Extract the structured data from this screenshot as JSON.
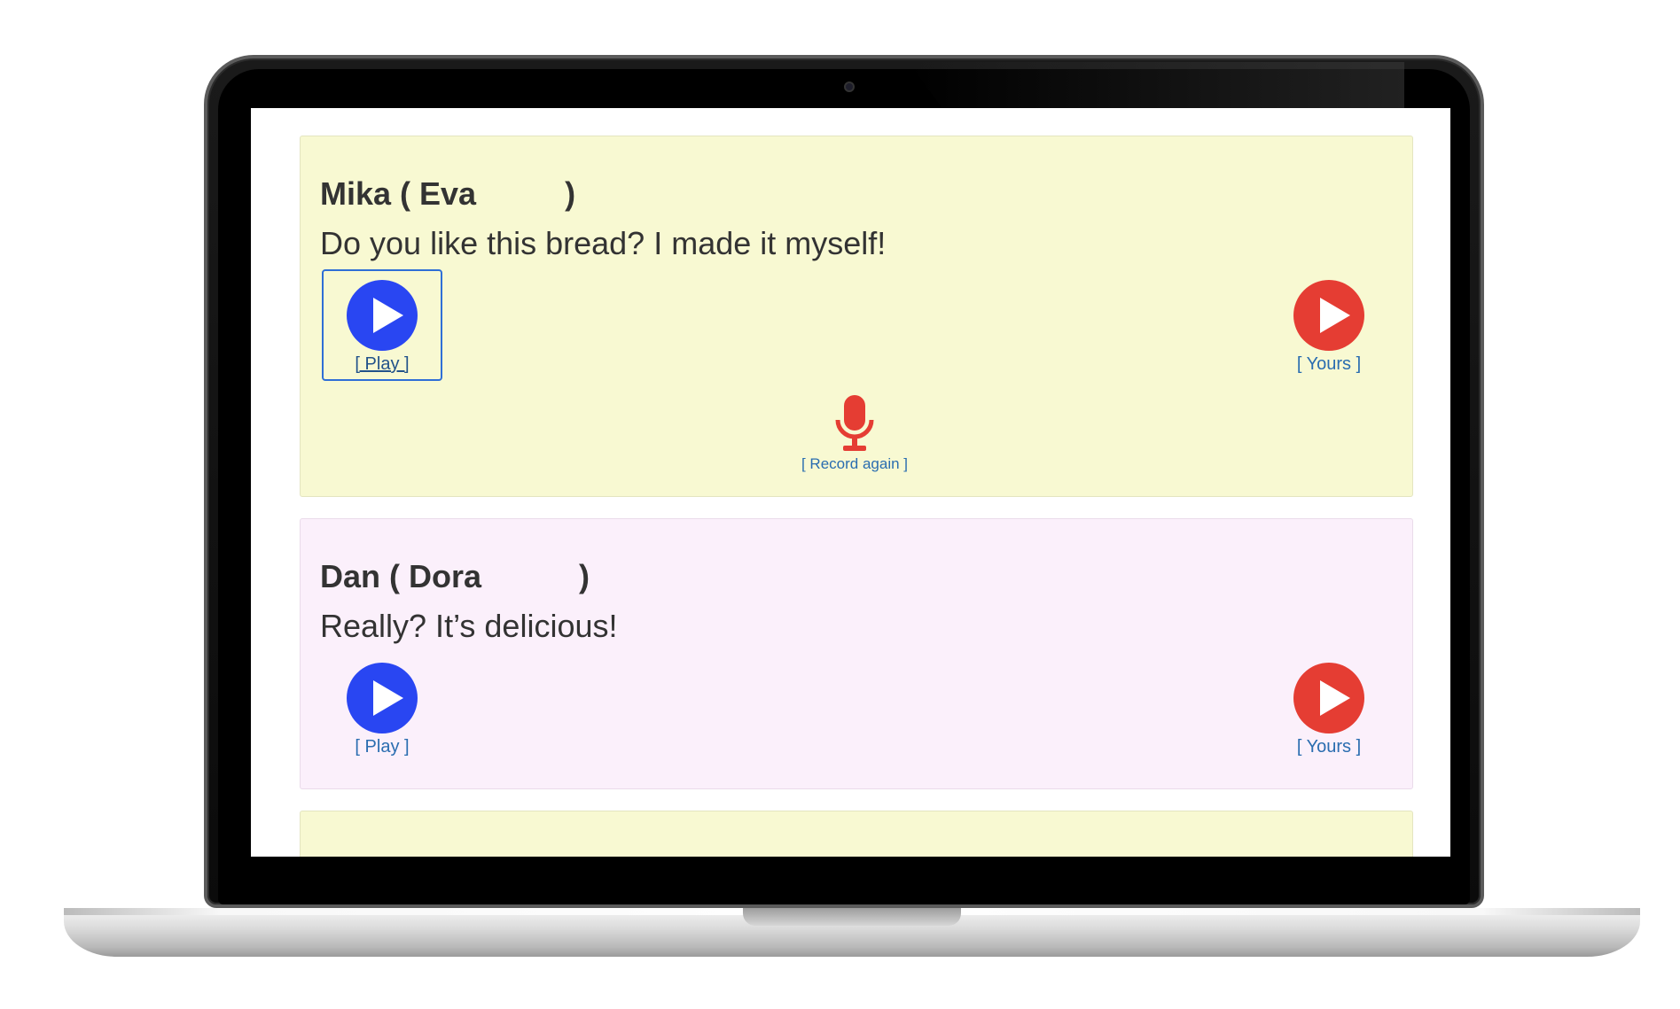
{
  "cards": [
    {
      "speaker": "Mika ( Eva          )",
      "line": "Do you like this bread? I made it myself!",
      "play_label": "[ Play ]",
      "yours_label": "[ Yours ]",
      "record_label": "[ Record again ]"
    },
    {
      "speaker": "Dan ( Dora           )",
      "line": "Really? It’s delicious!",
      "play_label": "[ Play ]",
      "yours_label": "[ Yours ]"
    }
  ],
  "colors": {
    "play": "#2946f2",
    "yours": "#e53d33",
    "card_yellow": "#f8f9d2",
    "card_pink": "#fbf0fb"
  }
}
